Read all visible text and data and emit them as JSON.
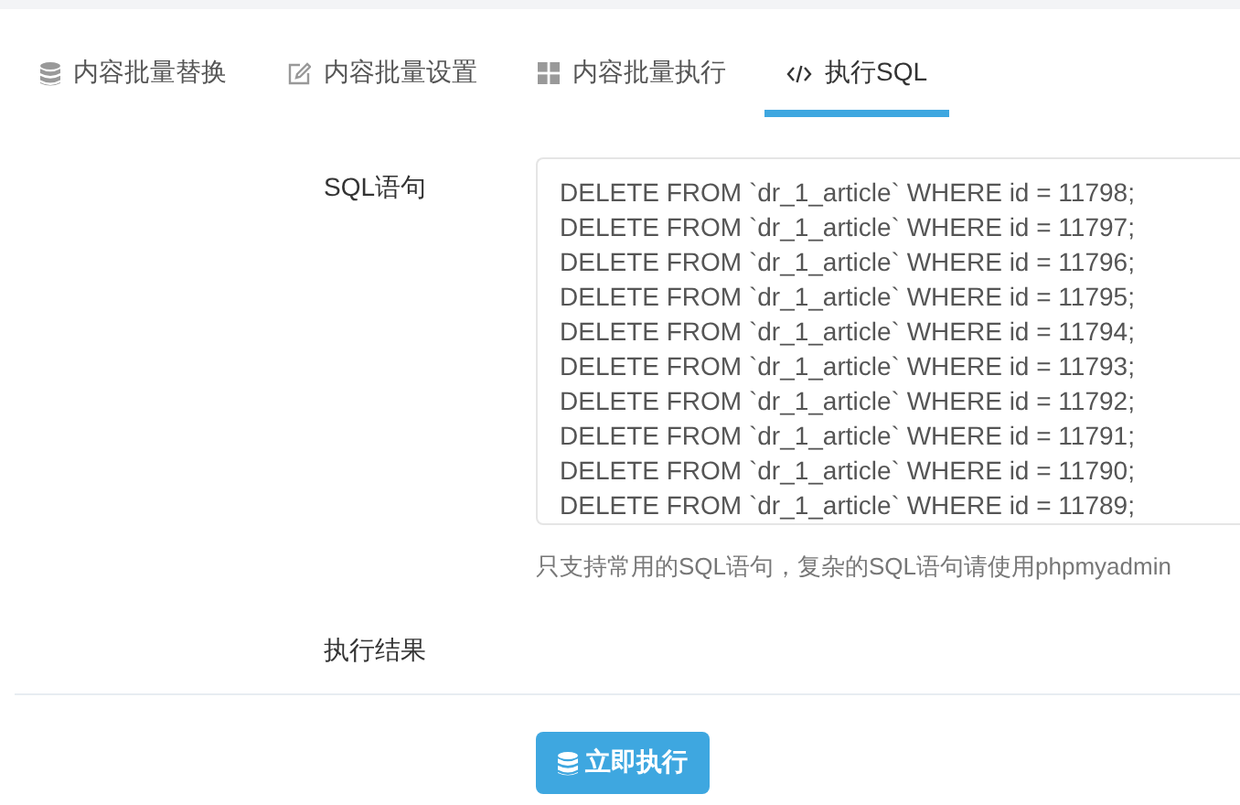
{
  "tabs": [
    {
      "label": "内容批量替换",
      "selected": false
    },
    {
      "label": "内容批量设置",
      "selected": false
    },
    {
      "label": "内容批量执行",
      "selected": false
    },
    {
      "label": "执行SQL",
      "selected": true
    }
  ],
  "form": {
    "sql_label": "SQL语句",
    "sql_lines": [
      "DELETE FROM `dr_1_article` WHERE id = 11798;",
      "DELETE FROM `dr_1_article` WHERE id = 11797;",
      "DELETE FROM `dr_1_article` WHERE id = 11796;",
      "DELETE FROM `dr_1_article` WHERE id = 11795;",
      "DELETE FROM `dr_1_article` WHERE id = 11794;",
      "DELETE FROM `dr_1_article` WHERE id = 11793;",
      "DELETE FROM `dr_1_article` WHERE id = 11792;",
      "DELETE FROM `dr_1_article` WHERE id = 11791;",
      "DELETE FROM `dr_1_article` WHERE id = 11790;",
      "DELETE FROM `dr_1_article` WHERE id = 11789;"
    ],
    "hint": "只支持常用的SQL语句，复杂的SQL语句请使用phpmyadmin",
    "result_label": "执行结果"
  },
  "submit_button": {
    "label": "立即执行"
  }
}
